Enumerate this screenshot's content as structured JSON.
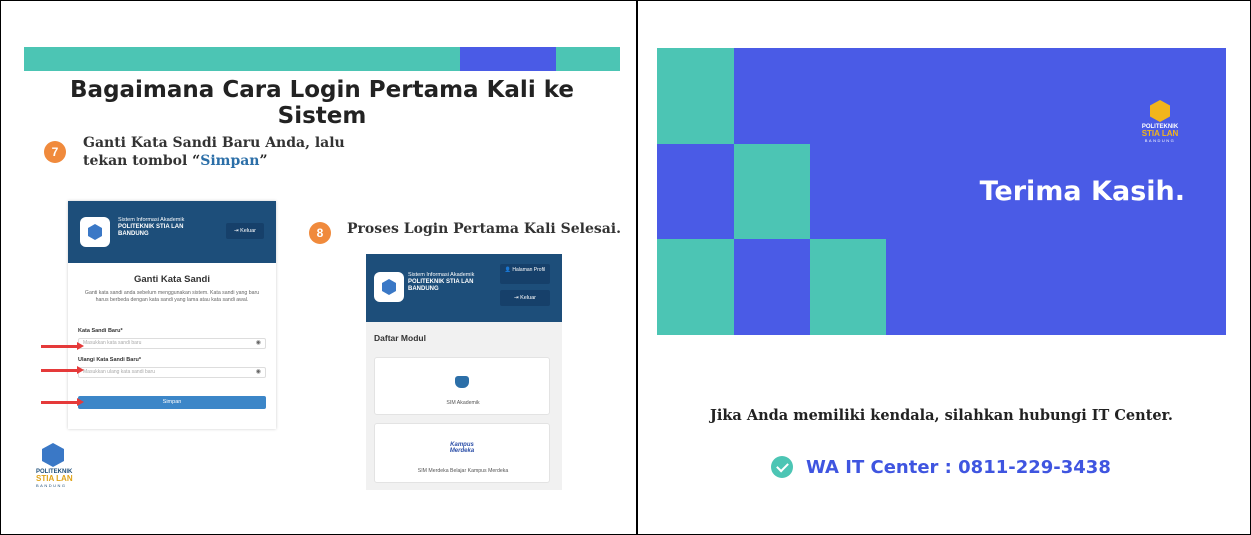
{
  "left_slide": {
    "title": "Bagaimana Cara Login Pertama Kali ke Sistem",
    "step7": {
      "number": "7",
      "text_before": "Ganti Kata Sandi Baru Anda, lalu tekan tombol ",
      "quote_open": "“",
      "button_word": "Simpan",
      "quote_close": "”"
    },
    "step8": {
      "number": "8",
      "text": "Proses Login Pertama Kali Selesai."
    },
    "form": {
      "sys_line1": "Sistem Informasi Akademik",
      "sys_line2": "POLITEKNIK STIA LAN",
      "sys_line3": "BANDUNG",
      "logout_label": "Keluar",
      "title": "Ganti Kata Sandi",
      "description": "Ganti kata sandi anda sebelum menggunakan sistem. Kata sandi yang baru harus berbeda dengan kata sandi yang lama atau kata sandi awal.",
      "new_password_label": "Kata Sandi Baru*",
      "new_password_placeholder": "Masukkan kata sandi baru",
      "repeat_password_label": "Ulangi Kata Sandi Baru*",
      "repeat_password_placeholder": "Masukkan ulang kata sandi baru",
      "submit_label": "Simpan"
    },
    "modules": {
      "sys_line1": "Sistem Informasi Akademik",
      "sys_line2": "POLITEKNIK STIA LAN",
      "sys_line3": "BANDUNG",
      "profile_label": "Halaman Profil",
      "logout_label": "Keluar",
      "heading": "Daftar Modul",
      "card1_label": "SIM Akademik",
      "card2_logo_text": "Kampus Merdeka",
      "card2_label": "SIM Merdeka Belajar Kampus Merdeka"
    },
    "logo": {
      "line1": "POLITEKNIK",
      "line2": "STIA LAN",
      "line3": "BANDUNG"
    }
  },
  "right_slide": {
    "logo": {
      "line1": "POLITEKNIK",
      "line2": "STIA LAN",
      "line3": "BANDUNG"
    },
    "thanks": "Terima Kasih.",
    "contact_note": "Jika Anda memiliki kendala, silahkan hubungi IT Center.",
    "wa_contact": "WA IT Center : 0811-229-3438"
  },
  "colors": {
    "teal": "#4cc5b4",
    "blue": "#4a5be6",
    "navy": "#1d4e7a",
    "orange": "#f08a3c",
    "red_arrow": "#e53a3a"
  }
}
